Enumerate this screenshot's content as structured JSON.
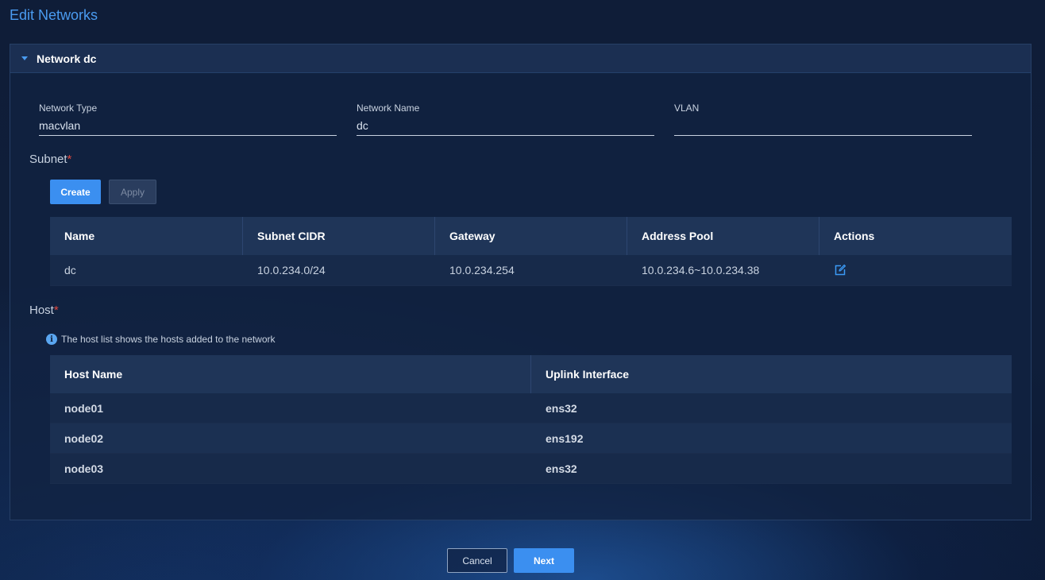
{
  "page_title": "Edit Networks",
  "panel": {
    "title": "Network dc",
    "fields": [
      {
        "label": "Network Type",
        "value": "macvlan"
      },
      {
        "label": "Network Name",
        "value": "dc"
      },
      {
        "label": "VLAN",
        "value": ""
      }
    ]
  },
  "subnet": {
    "label": "Subnet",
    "required_mark": "*",
    "create_label": "Create",
    "apply_label": "Apply",
    "columns": [
      "Name",
      "Subnet CIDR",
      "Gateway",
      "Address Pool",
      "Actions"
    ],
    "rows": [
      {
        "name": "dc",
        "cidr": "10.0.234.0/24",
        "gateway": "10.0.234.254",
        "pool": "10.0.234.6~10.0.234.38",
        "action_icon": "edit-icon"
      }
    ]
  },
  "host": {
    "label": "Host",
    "required_mark": "*",
    "info_text": "The host list shows the hosts added to the network",
    "columns": [
      "Host Name",
      "Uplink Interface"
    ],
    "rows": [
      {
        "host": "node01",
        "uplink": "ens32"
      },
      {
        "host": "node02",
        "uplink": "ens192"
      },
      {
        "host": "node03",
        "uplink": "ens32"
      }
    ]
  },
  "footer": {
    "cancel_label": "Cancel",
    "next_label": "Next"
  },
  "colors": {
    "accent": "#3b8ff0",
    "title": "#4a9bf0",
    "required": "#e0483e"
  }
}
